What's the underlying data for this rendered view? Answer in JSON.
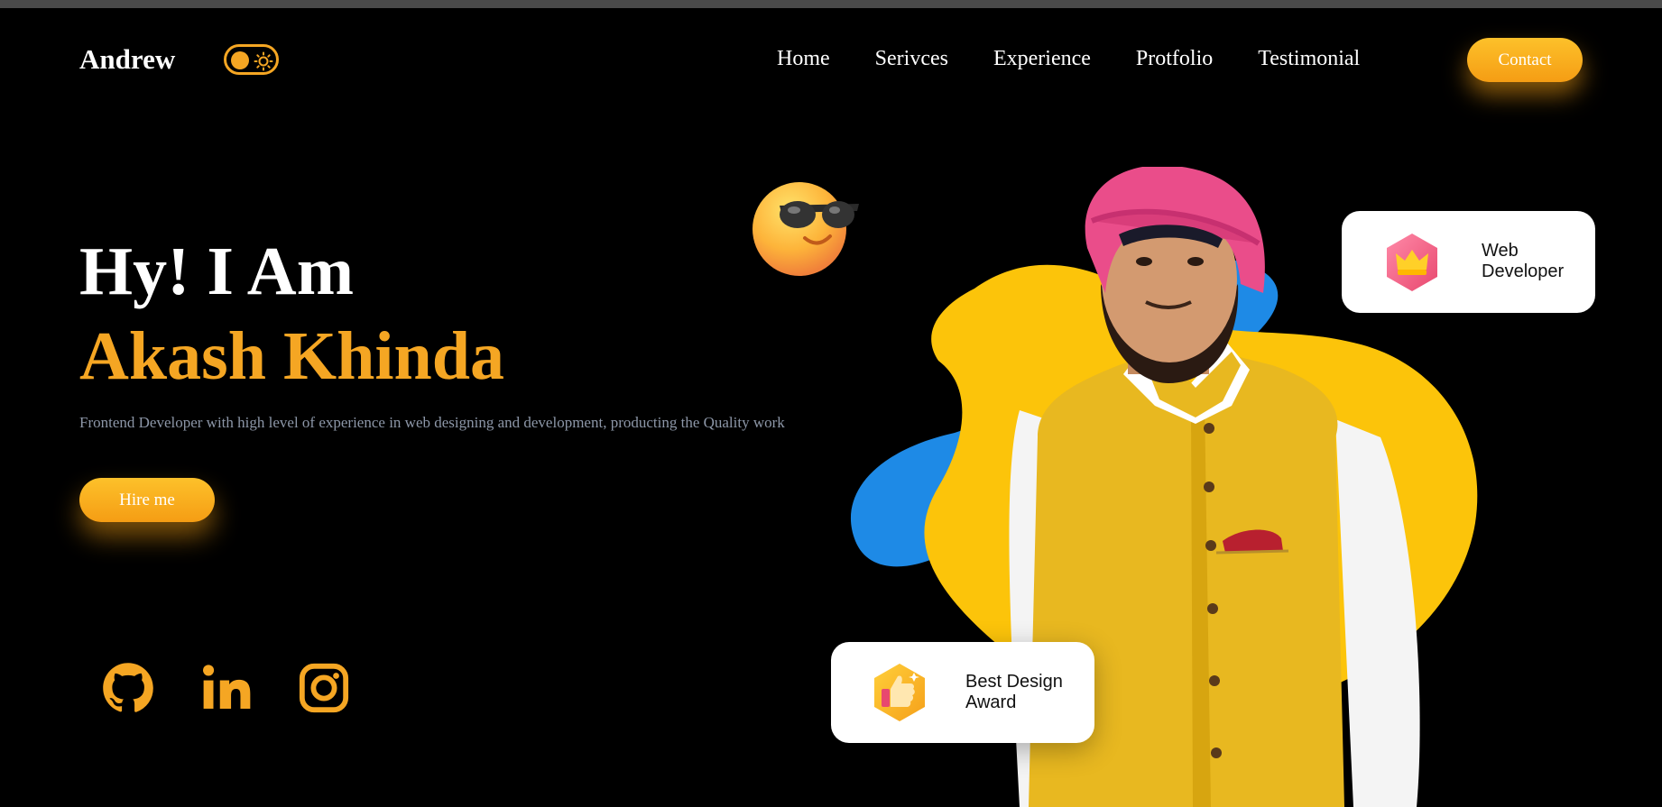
{
  "header": {
    "logo": "Andrew",
    "nav": [
      "Home",
      "Serivces",
      "Experience",
      "Protfolio",
      "Testimonial"
    ],
    "contact_label": "Contact"
  },
  "hero": {
    "greeting": "Hy! I Am",
    "name": "Akash Khinda",
    "description": "Frontend Developer with high level of experience in web designing and development, producting the Quality work",
    "hire_label": "Hire me"
  },
  "social": [
    "github-icon",
    "linkedin-icon",
    "instagram-icon"
  ],
  "cards": {
    "web_dev": [
      "Web",
      "Developer"
    ],
    "award": [
      "Best Design",
      "Award"
    ]
  },
  "colors": {
    "accent": "#f5a623",
    "background": "#000000",
    "blob_yellow": "#fcc40a",
    "blob_blue": "#1e8ae6",
    "muted_text": "#8d97a8"
  }
}
